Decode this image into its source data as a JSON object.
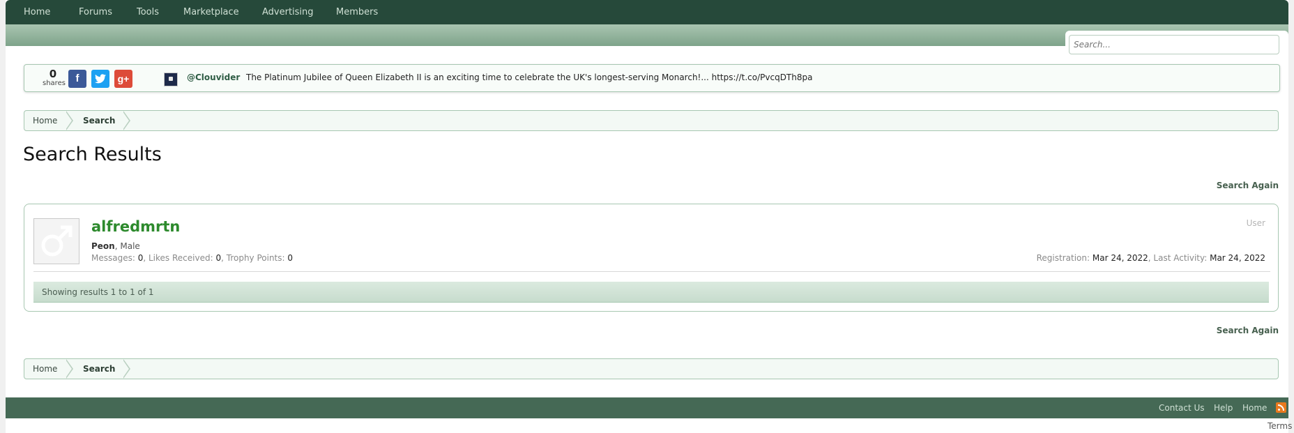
{
  "nav": {
    "items": [
      "Home",
      "Forums",
      "Tools",
      "Marketplace",
      "Advertising",
      "Members"
    ]
  },
  "search": {
    "placeholder": "Search..."
  },
  "share": {
    "count": "0",
    "count_label": "shares",
    "buttons": [
      {
        "label": "f",
        "icon": "facebook-icon",
        "color": "#3b5998"
      },
      {
        "label": "t",
        "icon": "twitter-icon",
        "color": "#1da1f2"
      },
      {
        "label": "g+",
        "icon": "google-plus-icon",
        "color": "#dd4b39"
      }
    ],
    "tweet_handle": "@Clouvider",
    "tweet_text": "The Platinum Jubilee of Queen Elizabeth II is an exciting time to celebrate the UK's longest-serving Monarch!... https://t.co/PvcqDTh8pa"
  },
  "breadcrumb": {
    "home": "Home",
    "current": "Search"
  },
  "page_title": "Search Results",
  "search_again": "Search Again",
  "result": {
    "username": "alfredmrtn",
    "type": "User",
    "title": "Peon",
    "gender": "Male",
    "messages_label": "Messages:",
    "messages": "0",
    "likes_label": "Likes Received:",
    "likes": "0",
    "trophy_label": "Trophy Points:",
    "trophy": "0",
    "registration_label": "Registration:",
    "registration": "Mar 24, 2022",
    "last_activity_label": "Last Activity:",
    "last_activity": "Mar 24, 2022"
  },
  "pager_text": "Showing results 1 to 1 of 1",
  "footer": {
    "links": [
      "Contact Us",
      "Help",
      "Home"
    ],
    "terms": "Terms"
  },
  "colors": {
    "nav_bg": "#26493a",
    "footer_bg": "#456955",
    "username": "#2d8a2d",
    "accent_border": "#a7c7b1"
  }
}
